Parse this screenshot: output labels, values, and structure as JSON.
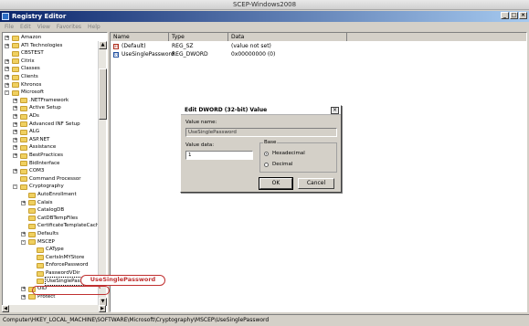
{
  "host_title": "SCEP-Windows2008",
  "window": {
    "title": "Registry Editor",
    "buttons": [
      "_",
      "□",
      "×"
    ]
  },
  "menu": [
    "File",
    "Edit",
    "View",
    "Favorites",
    "Help"
  ],
  "tree": [
    {
      "label": "Amazon",
      "level": 0,
      "exp": "+"
    },
    {
      "label": "ATI Technologies",
      "level": 0,
      "exp": "+"
    },
    {
      "label": "CBSTEST",
      "level": 0,
      "exp": ""
    },
    {
      "label": "Citrix",
      "level": 0,
      "exp": "+"
    },
    {
      "label": "Classes",
      "level": 0,
      "exp": "+"
    },
    {
      "label": "Clients",
      "level": 0,
      "exp": "+"
    },
    {
      "label": "Khronos",
      "level": 0,
      "exp": "+"
    },
    {
      "label": "Microsoft",
      "level": 0,
      "exp": "-"
    },
    {
      "label": ".NETFramework",
      "level": 1,
      "exp": "+"
    },
    {
      "label": "Active Setup",
      "level": 1,
      "exp": "+"
    },
    {
      "label": "ADs",
      "level": 1,
      "exp": "+"
    },
    {
      "label": "Advanced INF Setup",
      "level": 1,
      "exp": "+"
    },
    {
      "label": "ALG",
      "level": 1,
      "exp": "+"
    },
    {
      "label": "ASP.NET",
      "level": 1,
      "exp": "+"
    },
    {
      "label": "Assistance",
      "level": 1,
      "exp": "+"
    },
    {
      "label": "BestPractices",
      "level": 1,
      "exp": "+"
    },
    {
      "label": "BidInterface",
      "level": 1,
      "exp": ""
    },
    {
      "label": "COM3",
      "level": 1,
      "exp": "+"
    },
    {
      "label": "Command Processor",
      "level": 1,
      "exp": ""
    },
    {
      "label": "Cryptography",
      "level": 1,
      "exp": "-"
    },
    {
      "label": "AutoEnrollment",
      "level": 2,
      "exp": ""
    },
    {
      "label": "Calais",
      "level": 2,
      "exp": "+"
    },
    {
      "label": "CatalogDB",
      "level": 2,
      "exp": ""
    },
    {
      "label": "CatDBTempFiles",
      "level": 2,
      "exp": ""
    },
    {
      "label": "CertificateTemplateCache",
      "level": 2,
      "exp": ""
    },
    {
      "label": "Defaults",
      "level": 2,
      "exp": "+"
    },
    {
      "label": "MSCEP",
      "level": 2,
      "exp": "-"
    },
    {
      "label": "CAType",
      "level": 3,
      "exp": ""
    },
    {
      "label": "CertsInMYStore",
      "level": 3,
      "exp": ""
    },
    {
      "label": "EnforcePassword",
      "level": 3,
      "exp": ""
    },
    {
      "label": "PasswordVDir",
      "level": 3,
      "exp": ""
    },
    {
      "label": "UseSinglePassword",
      "level": 3,
      "exp": "",
      "selected": true
    },
    {
      "label": "OID",
      "level": 2,
      "exp": "+"
    },
    {
      "label": "Protect",
      "level": 2,
      "exp": "+"
    }
  ],
  "list": {
    "columns": [
      "Name",
      "Type",
      "Data"
    ],
    "rows": [
      {
        "icon": "ab",
        "name": "(Default)",
        "type": "REG_SZ",
        "data": "(value not set)"
      },
      {
        "icon": "bin",
        "name": "UseSinglePassword",
        "type": "REG_DWORD",
        "data": "0x00000000 (0)"
      }
    ]
  },
  "dialog": {
    "title": "Edit DWORD (32-bit) Value",
    "close": "×",
    "value_name_label": "Value name:",
    "value_name": "UseSinglePassword",
    "value_data_label": "Value data:",
    "value_data": "1",
    "base_label": "Base",
    "hex_label": "Hexadecimal",
    "dec_label": "Decimal",
    "ok": "OK",
    "cancel": "Cancel"
  },
  "callout": "UseSinglePassword",
  "status": "Computer\\HKEY_LOCAL_MACHINE\\SOFTWARE\\Microsoft\\Cryptography\\MSCEP\\UseSinglePassword",
  "colors": {
    "titlebar": "#0a246a",
    "callout": "#c03030",
    "folder": "#f0d060"
  }
}
